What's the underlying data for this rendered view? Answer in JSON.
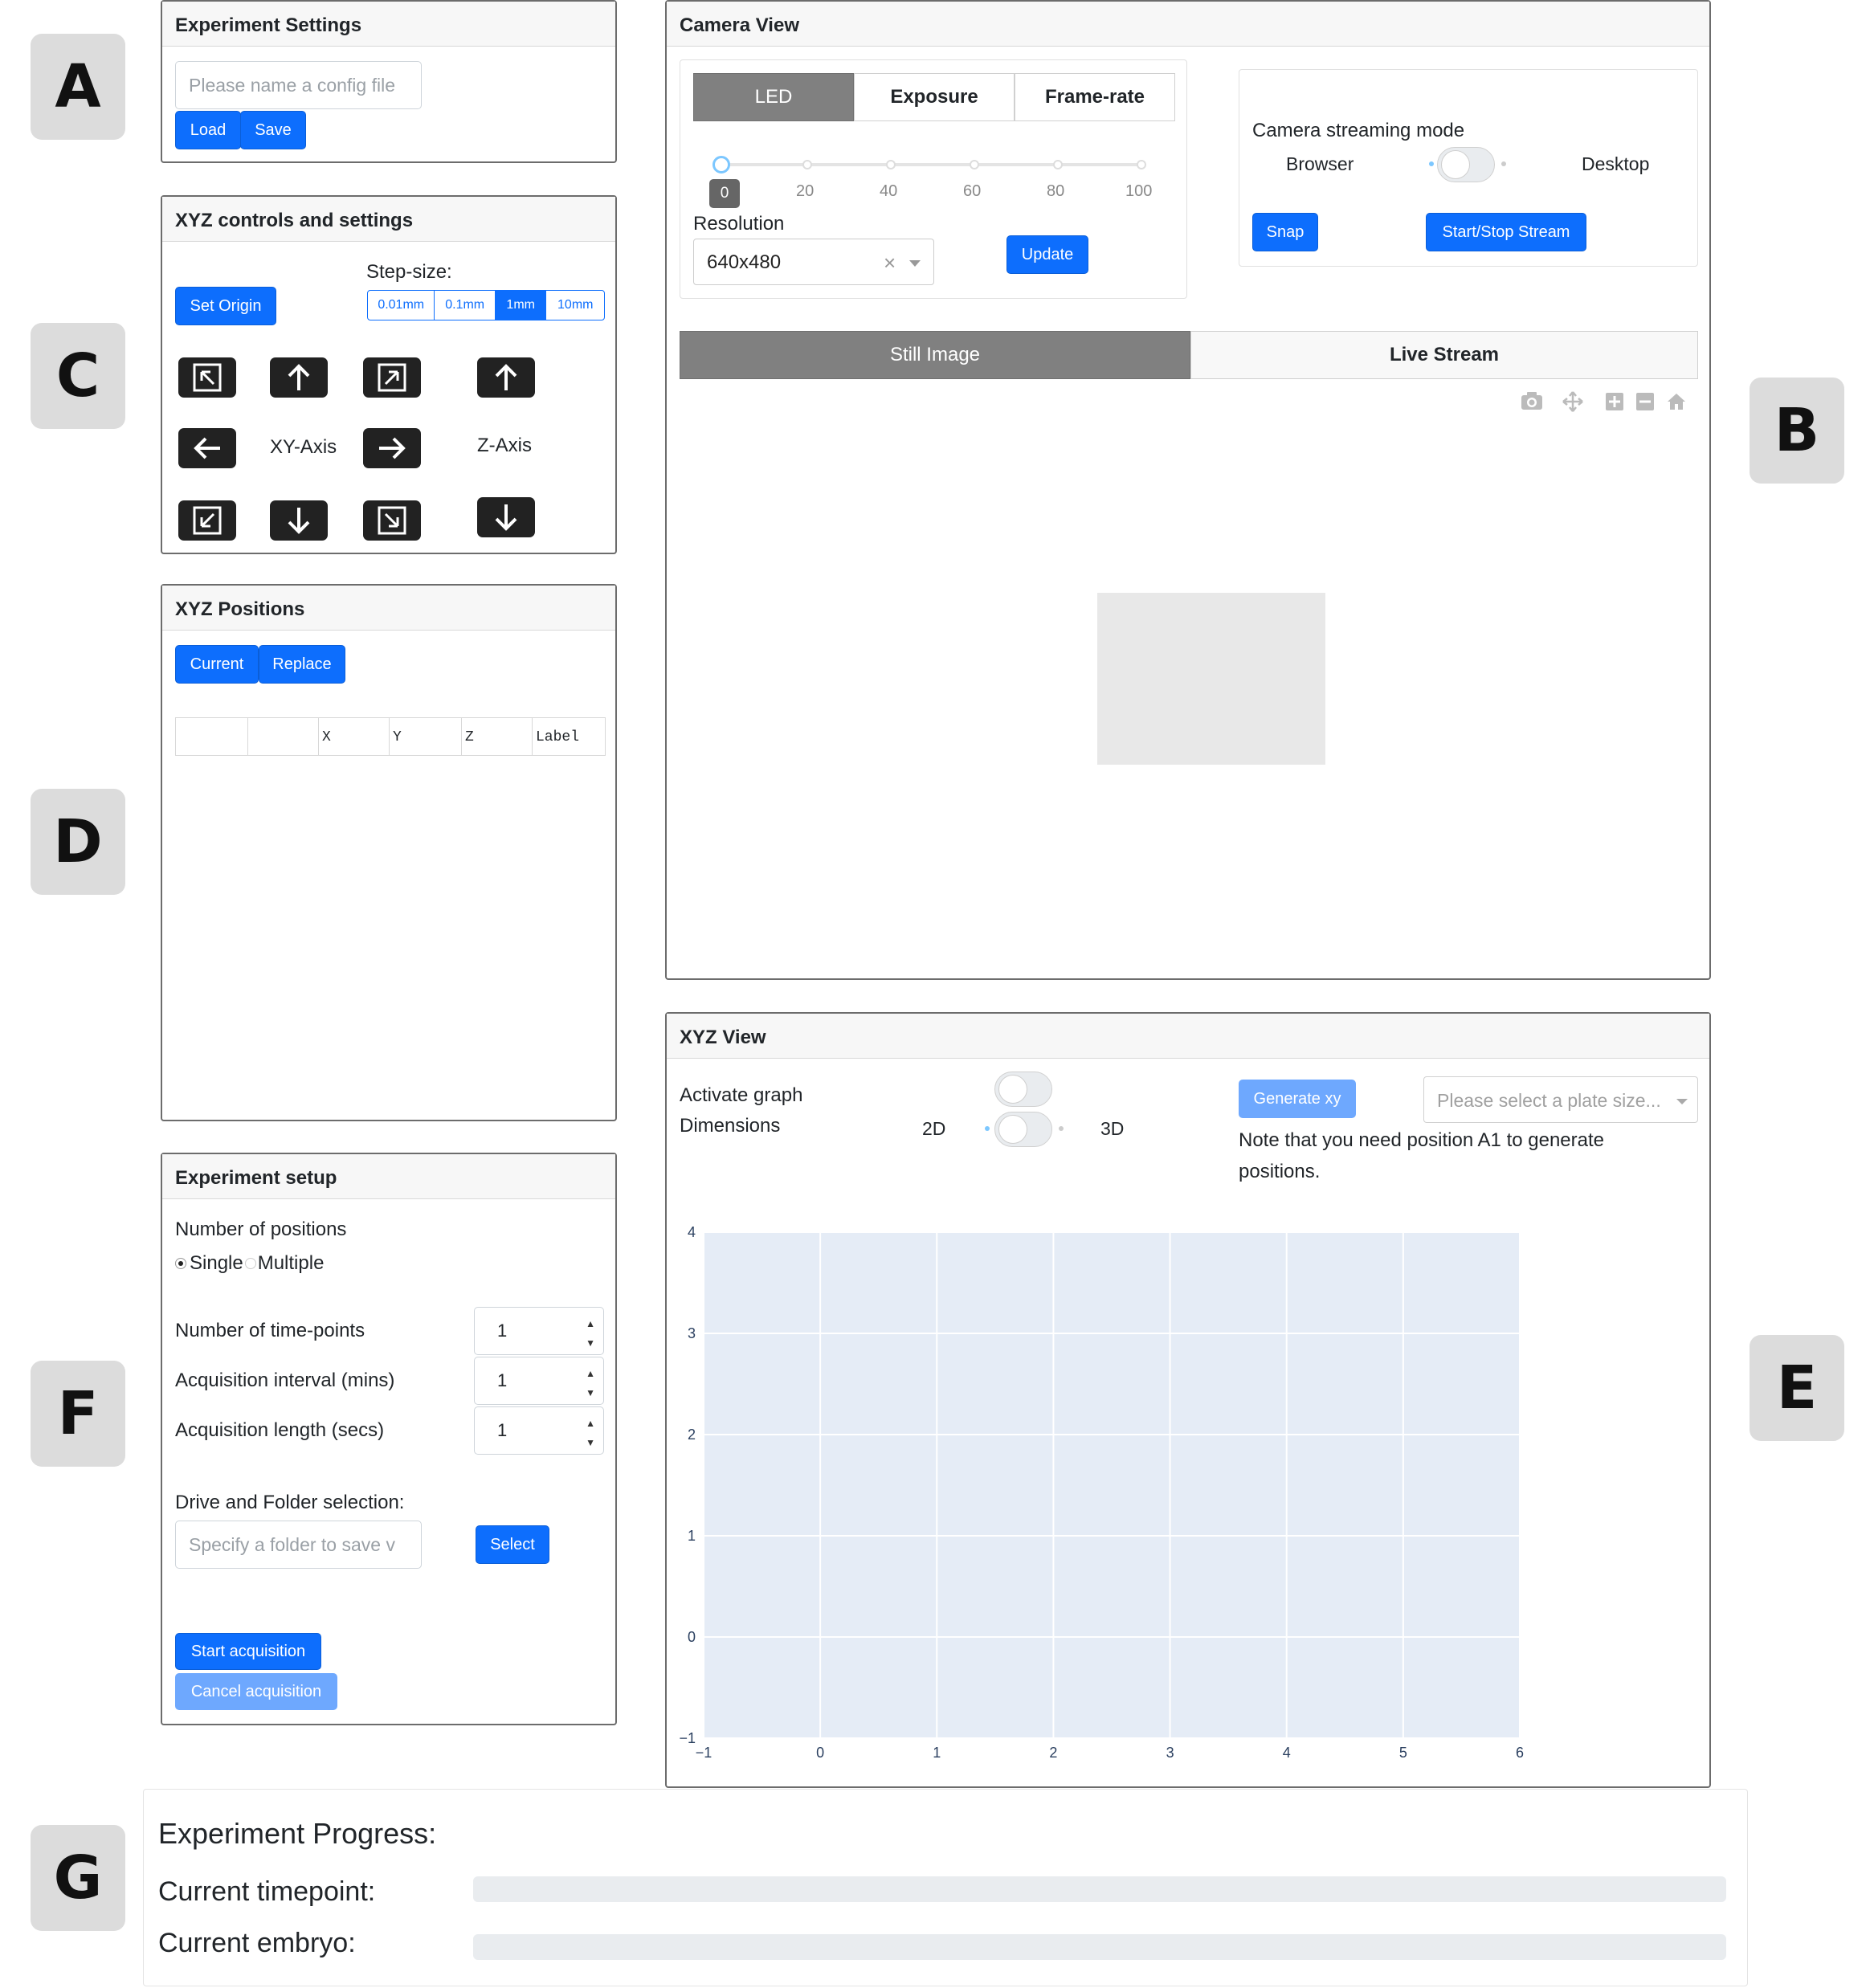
{
  "panel_badges": {
    "a": "A",
    "b": "B",
    "c": "C",
    "d": "D",
    "e": "E",
    "f": "F",
    "g": "G"
  },
  "experiment_settings": {
    "title": "Experiment Settings",
    "config_placeholder": "Please name a config file",
    "load_label": "Load",
    "save_label": "Save"
  },
  "xyz_controls": {
    "title": "XYZ controls and settings",
    "set_origin_label": "Set Origin",
    "step_size_label": "Step-size:",
    "step_sizes": [
      "0.01mm",
      "0.1mm",
      "1mm",
      "10mm"
    ],
    "step_selected": "1mm",
    "xy_axis_label": "XY-Axis",
    "z_axis_label": "Z-Axis"
  },
  "xyz_positions": {
    "title": "XYZ Positions",
    "current_label": "Current",
    "replace_label": "Replace",
    "columns": [
      "",
      "",
      "X",
      "Y",
      "Z",
      "Label"
    ]
  },
  "experiment_setup": {
    "title": "Experiment setup",
    "num_positions_label": "Number of positions",
    "radio_single": "Single",
    "radio_multiple": "Multiple",
    "radio_selected": "Single",
    "timepoints_label": "Number of time-points",
    "timepoints_value": "1",
    "interval_label": "Acquisition interval (mins)",
    "interval_value": "1",
    "length_label": "Acquisition length (secs)",
    "length_value": "1",
    "drive_label": "Drive and Folder selection:",
    "folder_placeholder": "Specify a folder to save v",
    "select_label": "Select",
    "start_label": "Start acquisition",
    "cancel_label": "Cancel acquisition"
  },
  "camera_view": {
    "title": "Camera View",
    "tabs": [
      "LED",
      "Exposure",
      "Frame-rate"
    ],
    "active_tab": "LED",
    "slider_value": 0,
    "slider_value_label": "0",
    "slider_ticks": [
      "20",
      "40",
      "60",
      "80",
      "100"
    ],
    "resolution_label": "Resolution",
    "resolution_value": "640x480",
    "clear_glyph": "×",
    "update_label": "Update",
    "streaming_mode_label": "Camera streaming mode",
    "browser_label": "Browser",
    "desktop_label": "Desktop",
    "snap_label": "Snap",
    "start_stop_label": "Start/Stop Stream",
    "view_tabs": [
      "Still Image",
      "Live Stream"
    ],
    "active_view_tab": "Still Image",
    "toolbar_icons": [
      "camera-icon",
      "pan-icon",
      "zoom-in-icon",
      "zoom-out-icon",
      "home-icon"
    ]
  },
  "xyz_view": {
    "title": "XYZ View",
    "activate_label": "Activate graph",
    "dimensions_label": "Dimensions",
    "dim_2d": "2D",
    "dim_3d": "3D",
    "generate_label": "Generate xy",
    "plate_placeholder": "Please select a plate size...",
    "note": "Note that you need position A1 to generate positions."
  },
  "chart_data": {
    "type": "scatter",
    "x_ticks": [
      "−1",
      "0",
      "1",
      "2",
      "3",
      "4",
      "5",
      "6"
    ],
    "y_ticks": [
      "−1",
      "0",
      "1",
      "2",
      "3",
      "4"
    ],
    "xlim": [
      -1,
      6
    ],
    "ylim": [
      -1,
      4
    ],
    "series": [],
    "grid": true,
    "background": "#e5ecf6"
  },
  "progress": {
    "title": "Experiment Progress:",
    "timepoint_label": "Current timepoint:",
    "timepoint_value": 0,
    "embryo_label": "Current embryo:",
    "embryo_value": 0
  },
  "colors": {
    "primary": "#0d6efd",
    "primary_light": "#6ea8fe",
    "tab_active": "#808080",
    "plot_bg": "#e5ecf6"
  }
}
